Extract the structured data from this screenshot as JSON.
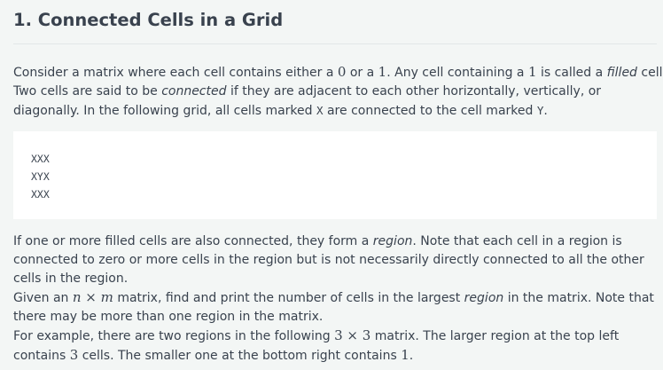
{
  "title": "1. Connected Cells in a Grid",
  "intro": {
    "l1a": "Consider a matrix where each cell contains either a ",
    "zero": "0",
    "l1b": " or a ",
    "one": "1",
    "l1c": ". Any cell containing a ",
    "one2": "1",
    "l1d": " is called a ",
    "filled": "filled",
    "l1e": " cell.",
    "l2a": "Two cells are said to be ",
    "connected": "connected",
    "l2b": " if they are adjacent to each other horizontally, vertically, or",
    "l3a": "diagonally. In the following grid, all cells marked ",
    "x": "X",
    "l3b": " are connected to the cell marked ",
    "y": "Y",
    "l3c": "."
  },
  "grid": [
    "XXX",
    "XYX",
    "XXX"
  ],
  "body": {
    "l1a": "If one or more filled cells are also connected, they form a ",
    "region": "region",
    "l1b": ". Note that each cell in a region is",
    "l2": "connected to zero or more cells in the region but is not necessarily directly connected to all the other",
    "l3": "cells in the region.",
    "l4a": "Given an ",
    "nxm": "n × m",
    "l4b": " matrix, find and print the number of cells in the largest ",
    "region2": "region",
    "l4c": " in the matrix. Note that",
    "l5": "there may be more than one region in the matrix.",
    "l6a": "For example, there are two regions in the following ",
    "three": "3 × 3",
    "l6b": " matrix. The larger region at the top left",
    "l7a": "contains ",
    "n3": "3",
    "l7b": " cells. The smaller one at the bottom right contains ",
    "n1": "1",
    "l7c": "."
  }
}
